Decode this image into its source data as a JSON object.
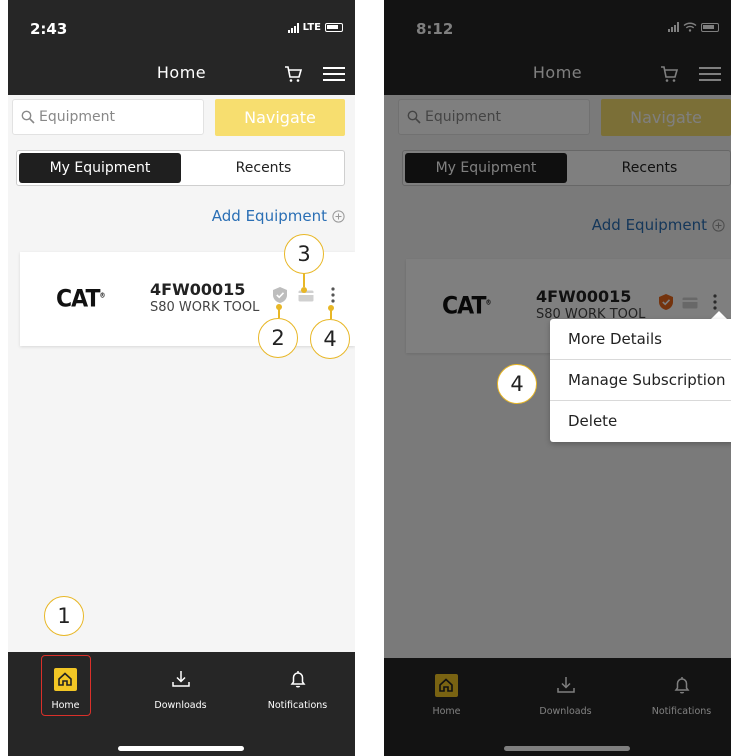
{
  "left_screen": {
    "status": {
      "time": "2:43",
      "network": "LTE"
    },
    "nav": {
      "title": "Home"
    },
    "search": {
      "placeholder": "Equipment"
    },
    "navigate_label": "Navigate",
    "segments": {
      "active": "My Equipment",
      "inactive": "Recents"
    },
    "add_equipment": "Add Equipment",
    "equipment": {
      "brand": "CAT",
      "serial": "4FW00015",
      "model": "S80 WORK TOOL"
    },
    "callouts": [
      "1",
      "2",
      "3",
      "4"
    ],
    "tabs": [
      {
        "label": "Home",
        "icon": "home-icon"
      },
      {
        "label": "Downloads",
        "icon": "download-icon"
      },
      {
        "label": "Notifications",
        "icon": "bell-icon"
      }
    ]
  },
  "right_screen": {
    "status": {
      "time": "8:12"
    },
    "nav": {
      "title": "Home"
    },
    "search": {
      "placeholder": "Equipment"
    },
    "navigate_label": "Navigate",
    "segments": {
      "active": "My Equipment",
      "inactive": "Recents"
    },
    "add_equipment": "Add Equipment",
    "equipment": {
      "brand": "CAT",
      "serial": "4FW00015",
      "model": "S80 WORK TOOL"
    },
    "menu": {
      "items": [
        "More Details",
        "Manage Subscription",
        "Delete"
      ]
    },
    "callout": "4",
    "tabs": [
      {
        "label": "Home",
        "icon": "home-icon"
      },
      {
        "label": "Downloads",
        "icon": "download-icon"
      },
      {
        "label": "Notifications",
        "icon": "bell-icon"
      }
    ]
  },
  "colors": {
    "header": "#262626",
    "accent": "#f7de6f",
    "link": "#2a6fb5",
    "callout": "#e8b726",
    "highlight": "#d9302a",
    "shield_active": "#e9671b"
  }
}
